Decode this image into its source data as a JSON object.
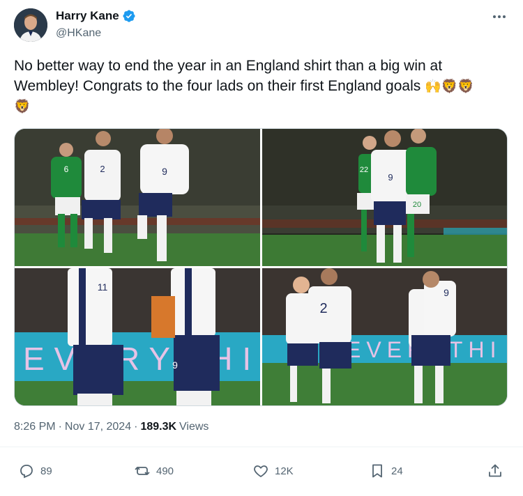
{
  "author": {
    "name": "Harry Kane",
    "handle": "@HKane",
    "verified_icon": "verified-badge-icon",
    "verified_color": "#1d9bf0"
  },
  "tweet": {
    "text_line1": "No better way to end the year in an England shirt than a big win at",
    "text_line2": "Wembley! Congrats to the four lads on their first England goals",
    "emoji_trailing": "🙌🦁🦁",
    "emoji_line3": "🦁"
  },
  "media": {
    "photos": [
      {
        "shirt_numbers": [
          "6",
          "2",
          "9"
        ],
        "description_icon": "photo-icon"
      },
      {
        "shirt_numbers": [
          "22",
          "9",
          "20"
        ],
        "description_icon": "photo-icon"
      },
      {
        "shirt_numbers": [
          "11",
          "9"
        ],
        "ad_board": "EVERYTHI",
        "description_icon": "photo-icon"
      },
      {
        "shirt_numbers": [
          "2",
          "9"
        ],
        "ad_board": "EVERYTHI",
        "description_icon": "photo-icon"
      }
    ]
  },
  "meta": {
    "time": "8:26 PM",
    "separator": "·",
    "date": "Nov 17, 2024",
    "views_count": "189.3K",
    "views_label": "Views"
  },
  "actions": {
    "replies": "89",
    "reposts": "490",
    "likes": "12K",
    "bookmarks": "24"
  },
  "colors": {
    "text_primary": "#0f1419",
    "text_secondary": "#536471",
    "accent": "#1d9bf0",
    "divider": "#eff3f4"
  }
}
